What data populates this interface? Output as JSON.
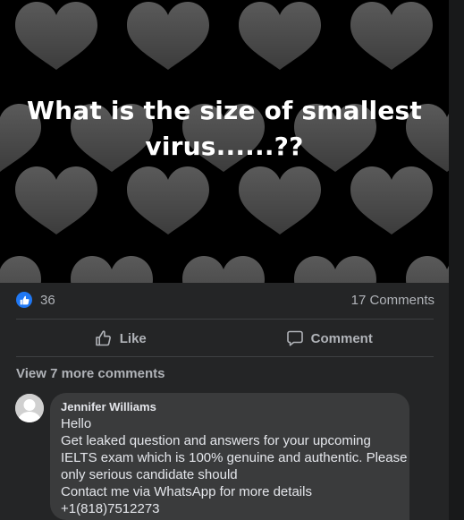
{
  "post": {
    "image_text_line1": "What is the size of smallest",
    "image_text_line2": "virus......??",
    "icon": "heart-pattern"
  },
  "stats": {
    "like_count": "36",
    "comment_count": "17 Comments",
    "like_badge_color": "#2078f4"
  },
  "actions": {
    "like_label": "Like",
    "comment_label": "Comment"
  },
  "comments": {
    "view_more_label": "View 7 more comments",
    "items": [
      {
        "author": "Jennifer Williams",
        "lines": [
          "Hello",
          "Get leaked question and answers for your upcoming",
          "IELTS exam which is 100% genuine and authentic. Please",
          "only serious candidate should",
          "Contact me via WhatsApp for more details",
          "+1(818)7512273"
        ]
      }
    ]
  },
  "colors": {
    "background": "#18191a",
    "card": "#242526",
    "bubble": "#3a3b3c",
    "secondary_text": "#b0b3b8",
    "primary_text": "#e4e6eb"
  }
}
